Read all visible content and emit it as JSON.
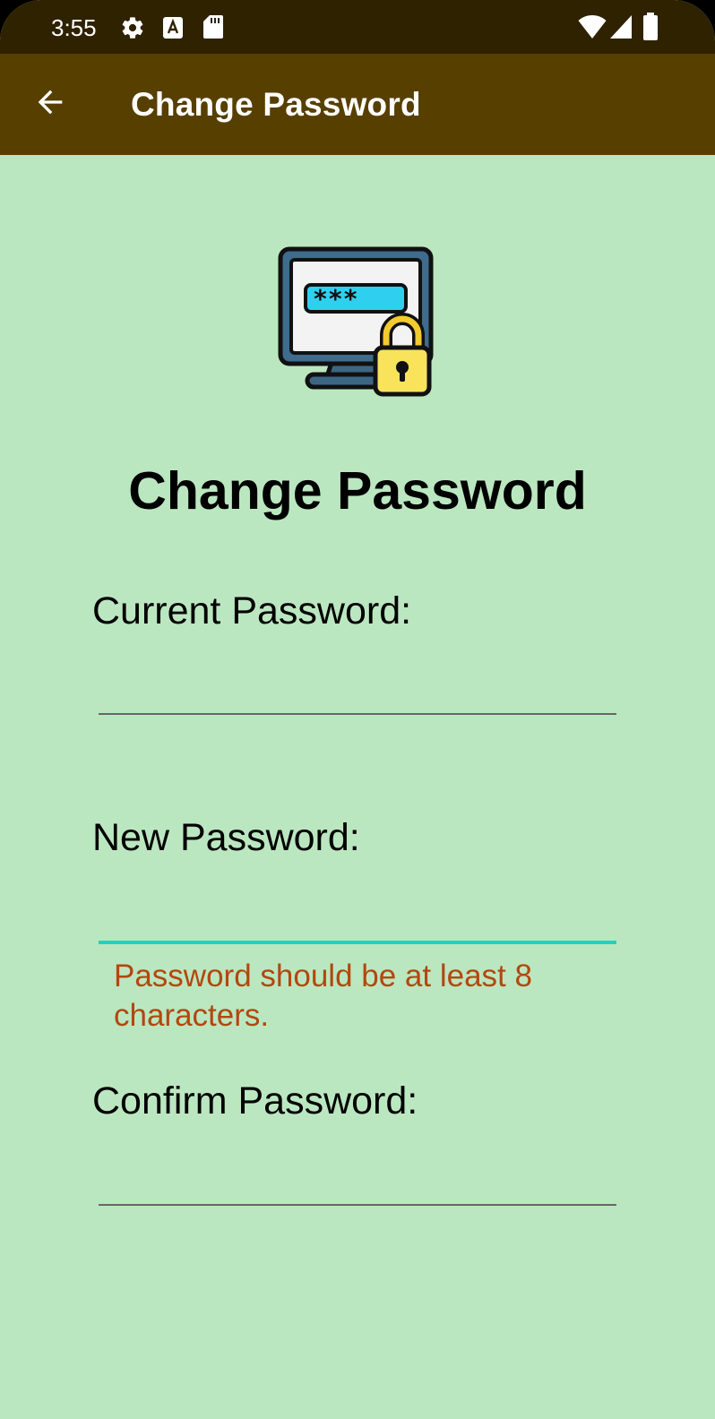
{
  "status_bar": {
    "time": "3:55",
    "icons": [
      "settings-icon",
      "text-a-icon",
      "sd-card-icon",
      "wifi-icon",
      "signal-icon",
      "battery-icon"
    ]
  },
  "app_bar": {
    "title": "Change Password",
    "back_icon": "arrow-left-icon"
  },
  "illustration": {
    "icon": "password-monitor-lock-icon",
    "masked_text": "***_"
  },
  "form": {
    "heading": "Change Password",
    "current_password": {
      "label": "Current Password:",
      "value": ""
    },
    "new_password": {
      "label": "New Password:",
      "value": "",
      "error": "Password should be at least 8 characters."
    },
    "confirm_password": {
      "label": "Confirm Password:",
      "value": ""
    }
  },
  "colors": {
    "status_bar": "#2f2200",
    "app_bar": "#573f00",
    "background": "#bbe7c0",
    "focus_underline": "#1ed3be",
    "error": "#b3470f"
  }
}
